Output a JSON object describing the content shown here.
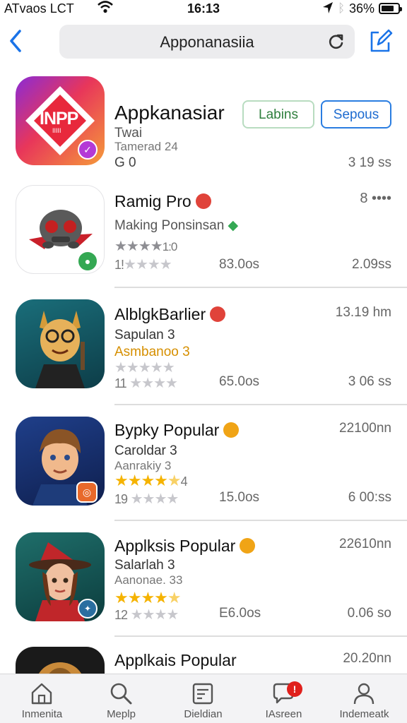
{
  "status_bar": {
    "carrier": "ATvaos LCT",
    "time": "16:13",
    "battery": "36%"
  },
  "nav": {
    "title": "Apponanasiia"
  },
  "featured": {
    "name": "Appkanasiar",
    "sub1": "Twai",
    "sub2": "Tamerad 24",
    "sub3": "G 0",
    "meta": "3 19 ss",
    "icon_text_main": "INPP",
    "icon_text_small": "IIIII",
    "buttons": {
      "labels": "Labins",
      "sepous": "Sepous"
    }
  },
  "apps": [
    {
      "name": "Ramig Pro",
      "badge_color": "#e0433a",
      "right_top": "8 ••••",
      "line1": "Making Ponsinsan",
      "rating_text": "1!",
      "rating_text2": "1:0",
      "count": "83.0os",
      "right_bottom": "2.09ss"
    },
    {
      "name": "AlblgkBarlier",
      "badge_color": "#e0433a",
      "right_top": "13.19 hm",
      "line1": "Sapulan 3",
      "line2": "Asmbanoo 3",
      "rating_text": "11",
      "count": "65.0os",
      "right_bottom": "3 06 ss"
    },
    {
      "name": "Bypky Popular",
      "badge_color": "#f0a416",
      "right_top": "22100nn",
      "line1": "Caroldar 3",
      "line2": "Aanrakiy 3",
      "rating_text": "19",
      "rating_suffix": "4",
      "count": "15.0os",
      "right_bottom": "6 00:ss"
    },
    {
      "name": "Applksis Popular",
      "badge_color": "#f0a416",
      "right_top": "22610nn",
      "line1": "Salarlah 3",
      "line2": "Aanonae. 33",
      "rating_text": "12",
      "count": "E6.0os",
      "right_bottom": "0.06 so"
    },
    {
      "name": "Applkais Popular",
      "right_top": "20.20nn"
    }
  ],
  "tabs": [
    {
      "label": "Inmenita"
    },
    {
      "label": "Meplp"
    },
    {
      "label": "Dieldian"
    },
    {
      "label": "IAsreen",
      "badge": "!"
    },
    {
      "label": "Indemeatk"
    }
  ],
  "colors": {
    "accent": "#1a73e8",
    "star": "#f5b301",
    "badge_red": "#e0201c"
  }
}
